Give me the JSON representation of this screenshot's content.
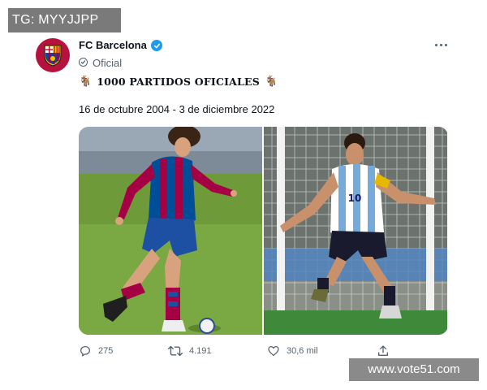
{
  "overlay": {
    "tg_label": "TG: MYYJJPP",
    "watermark": "www.vote51.com"
  },
  "tweet": {
    "author": {
      "name": "FC Barcelona",
      "verified": true,
      "affiliation_label": "Oficial",
      "avatar_logo": "fc-barcelona-crest"
    },
    "headline": {
      "emoji_left": "🐐",
      "text": "1000 PARTIDOS OFICIALES",
      "emoji_right": "🐐"
    },
    "dates_text": "16 de octubre 2004 - 3 de diciembre 2022",
    "media": [
      {
        "kind": "photo",
        "subject": "player-in-barcelona-kit",
        "colors": [
          "#a50044",
          "#004d98"
        ]
      },
      {
        "kind": "photo",
        "subject": "player-in-argentina-kit",
        "colors": [
          "#75aadb",
          "#ffffff"
        ]
      }
    ],
    "actions": {
      "reply_count": "275",
      "retweet_count": "4.191",
      "like_count": "30,6 mil"
    },
    "colors": {
      "verified_blue": "#1d9bf0",
      "muted_text": "#536471"
    }
  }
}
